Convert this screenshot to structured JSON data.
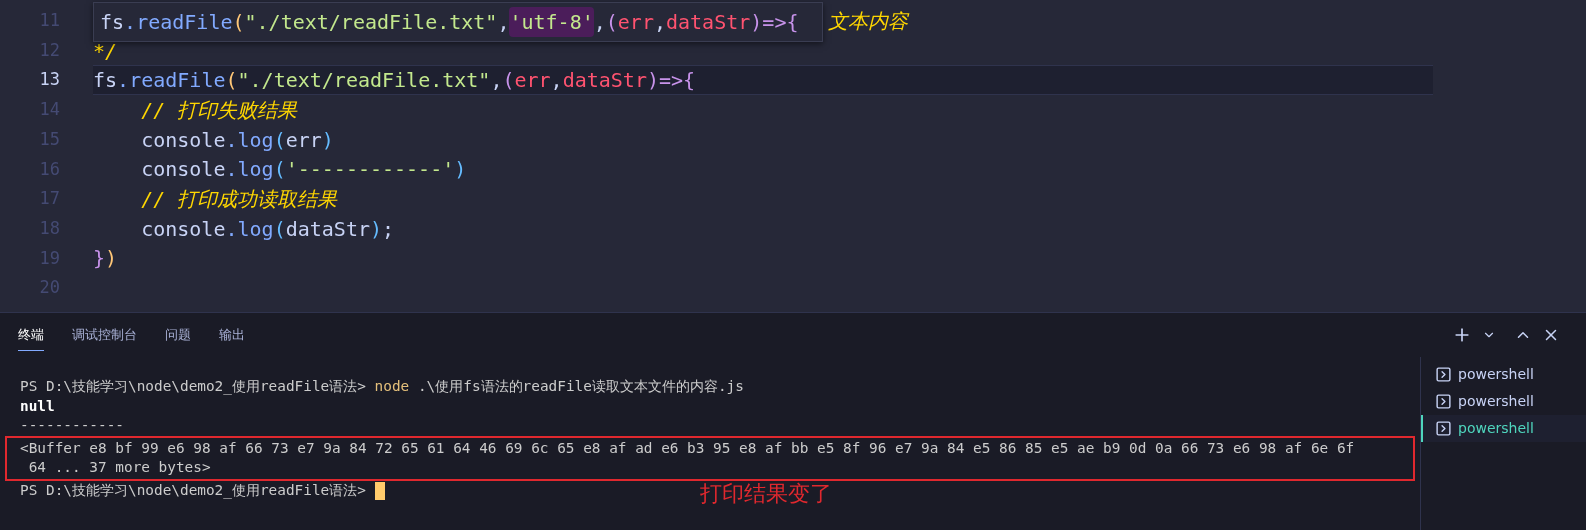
{
  "editor": {
    "peek": {
      "tokens": [
        {
          "text": "fs",
          "kind": "plain"
        },
        {
          "text": ".readFile",
          "kind": "method"
        },
        {
          "text": "(",
          "kind": "paren"
        },
        {
          "text": "\"./text/readFile.txt\"",
          "kind": "string"
        },
        {
          "text": ",",
          "kind": "plain"
        },
        {
          "text": "'utf-8'",
          "kind": "match"
        },
        {
          "text": ",",
          "kind": "plain"
        },
        {
          "text": "(",
          "kind": "arrow"
        },
        {
          "text": "err",
          "kind": "param"
        },
        {
          "text": ",",
          "kind": "plain"
        },
        {
          "text": "dataStr",
          "kind": "param"
        },
        {
          "text": ")=>{",
          "kind": "arrow"
        }
      ]
    },
    "lines": [
      {
        "number": "11",
        "current": false,
        "tokens": [
          {
            "text": "文本内容",
            "kind": "comment"
          }
        ]
      },
      {
        "number": "12",
        "current": false,
        "tokens": [
          {
            "text": "*/",
            "kind": "comment"
          }
        ]
      },
      {
        "number": "13",
        "current": true,
        "tokens": [
          {
            "text": "fs",
            "kind": "plain"
          },
          {
            "text": ".readFile",
            "kind": "method"
          },
          {
            "text": "(",
            "kind": "paren"
          },
          {
            "text": "\"./text/readFile.txt\"",
            "kind": "string"
          },
          {
            "text": ",",
            "kind": "plain"
          },
          {
            "text": "(",
            "kind": "arrow"
          },
          {
            "text": "err",
            "kind": "param"
          },
          {
            "text": ",",
            "kind": "plain"
          },
          {
            "text": "dataStr",
            "kind": "param"
          },
          {
            "text": ")=>{",
            "kind": "arrow"
          }
        ]
      },
      {
        "number": "14",
        "current": false,
        "tokens": [
          {
            "text": "    // 打印失败结果",
            "kind": "comment"
          }
        ]
      },
      {
        "number": "15",
        "current": false,
        "tokens": [
          {
            "text": "    console",
            "kind": "plain"
          },
          {
            "text": ".log",
            "kind": "method"
          },
          {
            "text": "(",
            "kind": "paren2"
          },
          {
            "text": "err",
            "kind": "plain"
          },
          {
            "text": ")",
            "kind": "paren2"
          }
        ]
      },
      {
        "number": "16",
        "current": false,
        "tokens": [
          {
            "text": "    console",
            "kind": "plain"
          },
          {
            "text": ".log",
            "kind": "method"
          },
          {
            "text": "(",
            "kind": "paren2"
          },
          {
            "text": "'------------'",
            "kind": "string"
          },
          {
            "text": ")",
            "kind": "paren2"
          }
        ]
      },
      {
        "number": "17",
        "current": false,
        "tokens": [
          {
            "text": "    // 打印成功读取结果",
            "kind": "comment"
          }
        ]
      },
      {
        "number": "18",
        "current": false,
        "tokens": [
          {
            "text": "    console",
            "kind": "plain"
          },
          {
            "text": ".log",
            "kind": "method"
          },
          {
            "text": "(",
            "kind": "paren2"
          },
          {
            "text": "dataStr",
            "kind": "plain"
          },
          {
            "text": ")",
            "kind": "paren2"
          },
          {
            "text": ";",
            "kind": "plain"
          }
        ]
      },
      {
        "number": "19",
        "current": false,
        "tokens": [
          {
            "text": "}",
            "kind": "arrow"
          },
          {
            "text": ")",
            "kind": "paren"
          }
        ]
      },
      {
        "number": "20",
        "current": false
      }
    ]
  },
  "panel": {
    "tabs": [
      {
        "label": "终端",
        "selected": true
      },
      {
        "label": "调试控制台",
        "selected": false
      },
      {
        "label": "问题",
        "selected": false
      },
      {
        "label": "输出",
        "selected": false
      }
    ],
    "terminal": {
      "lines": [
        {
          "boxed": false,
          "tokens": [
            {
              "text": "PS D:\\技能学习\\node\\demo2_使用readFile语法> ",
              "kind": "plain"
            },
            {
              "text": "node",
              "kind": "command"
            },
            {
              "text": " .\\使用fs语法的readFile读取文本文件的内容.js",
              "kind": "plain"
            }
          ]
        },
        {
          "boxed": false,
          "tokens": [
            {
              "text": "null",
              "kind": "bold"
            }
          ]
        },
        {
          "boxed": false,
          "tokens": [
            {
              "text": "------------",
              "kind": "plain"
            }
          ]
        },
        {
          "boxed": true,
          "tokens": [
            {
              "text": "<Buffer e8 bf 99 e6 98 af 66 73 e7 9a 84 72 65 61 64 46 69 6c 65 e8 af ad e6 b3 95 e8 af bb e5 8f 96 e7 9a 84 e5 86 85 e5 ae b9 0d 0a 66 73 e6 98 af 6e 6f",
              "kind": "plain"
            }
          ]
        },
        {
          "boxed": true,
          "tokens": [
            {
              "text": " 64 ... 37 more bytes>",
              "kind": "plain"
            }
          ]
        },
        {
          "boxed": false,
          "cursor": true,
          "tokens": [
            {
              "text": "PS D:\\技能学习\\node\\demo2_使用readFile语法> ",
              "kind": "plain"
            }
          ]
        }
      ]
    },
    "annotation": "打印结果变了",
    "sessions": [
      {
        "label": "powershell",
        "selected": false
      },
      {
        "label": "powershell",
        "selected": false
      },
      {
        "label": "powershell",
        "selected": true
      }
    ]
  }
}
